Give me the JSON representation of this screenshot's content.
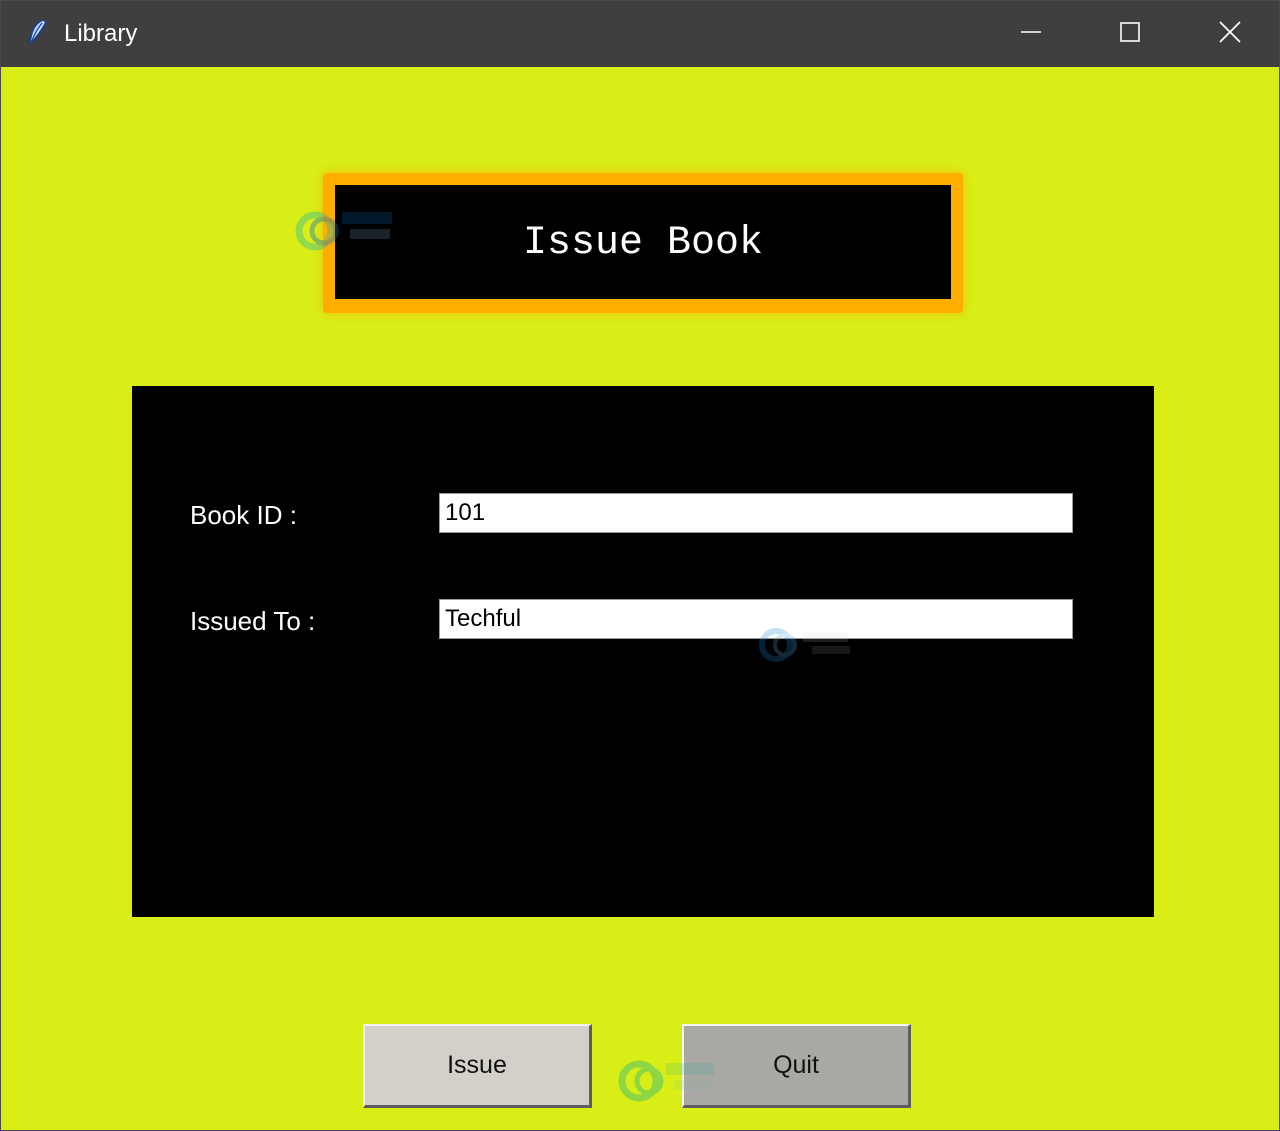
{
  "window": {
    "title": "Library",
    "icon": "feather-icon",
    "controls": {
      "minimize_icon": "minimize-icon",
      "maximize_icon": "maximize-icon",
      "close_icon": "close-icon"
    }
  },
  "header": {
    "title": "Issue Book"
  },
  "form": {
    "book_id": {
      "label": "Book ID :",
      "value": "101"
    },
    "issued_to": {
      "label": "Issued To :",
      "value": "Techful"
    }
  },
  "actions": {
    "issue_label": "Issue",
    "quit_label": "Quit"
  },
  "colors": {
    "background": "#d8ee16",
    "header_border": "#ffae00",
    "panel": "#000000",
    "title_bar": "#3f3f3f"
  }
}
